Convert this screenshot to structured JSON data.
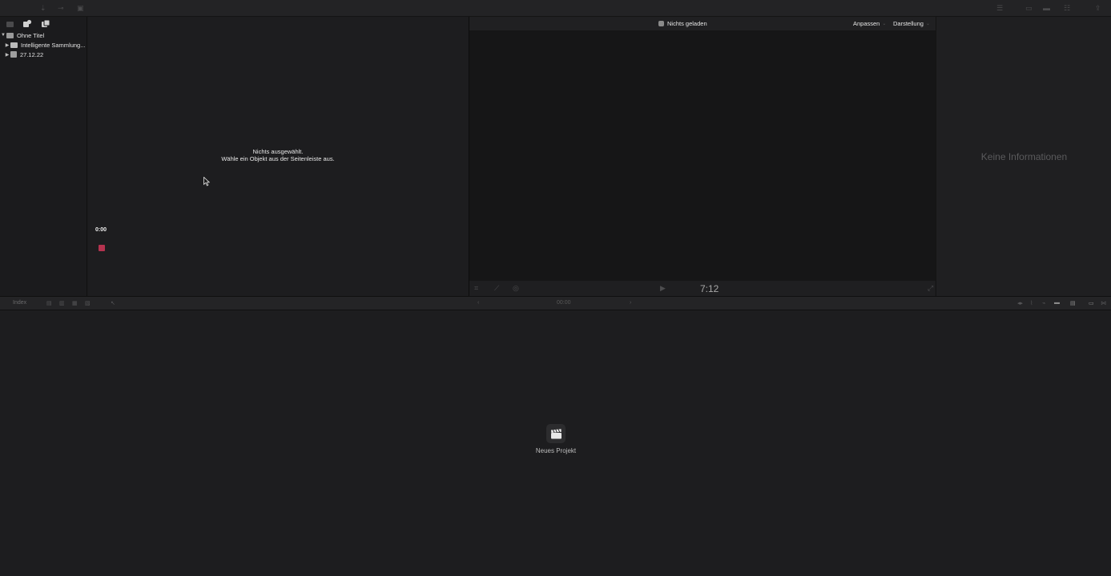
{
  "sidebar": {
    "library": {
      "name": "Ohne Titel"
    },
    "items": [
      {
        "label": "Intelligente Sammlung..."
      },
      {
        "label": "27.12.22"
      }
    ]
  },
  "browser": {
    "empty_line1": "Nichts ausgewählt.",
    "empty_line2": "Wähle ein Objekt aus der Seitenleiste aus.",
    "time": "0:00"
  },
  "viewer": {
    "title": "Nichts geladen",
    "fit_label": "Anpassen",
    "view_label": "Darstellung",
    "timecode": "7:12"
  },
  "inspector": {
    "message": "Keine Informationen"
  },
  "timeline_bar": {
    "index_label": "Index",
    "time": "00:00"
  },
  "timeline": {
    "new_project_label": "Neues Projekt"
  },
  "colors": {
    "record": "#b5334f",
    "background": "#1c1c1e"
  }
}
